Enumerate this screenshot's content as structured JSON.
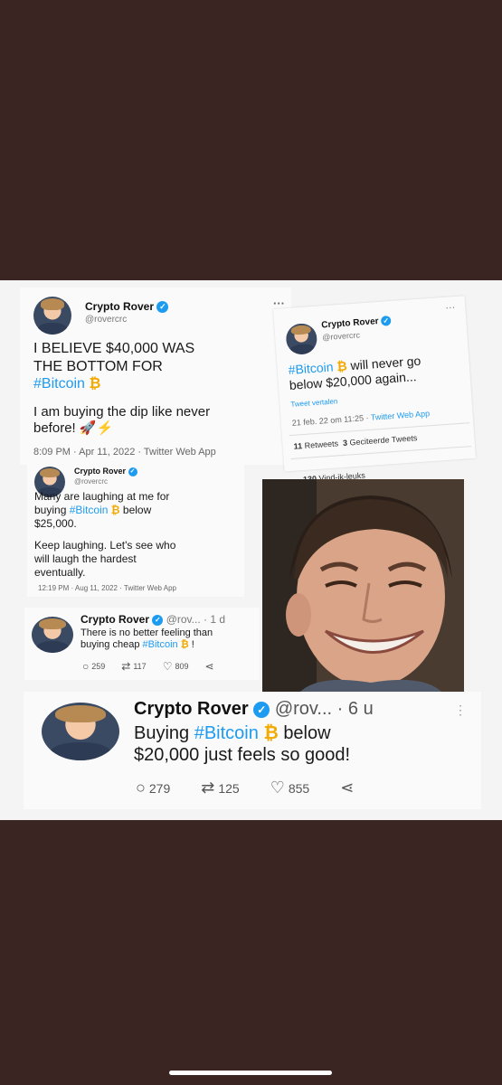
{
  "tweets": [
    {
      "name": "Crypto Rover",
      "handle": "@rovercrc",
      "more": "···",
      "line1": "I BELIEVE $40,000 WAS",
      "line2": "THE BOTTOM FOR",
      "hashtag": "#Bitcoin",
      "btc": "₿",
      "line3": "I am buying the dip like never",
      "line4": "before! 🚀⚡",
      "meta": "8:09 PM · Apr 11, 2022 · Twitter Web App"
    },
    {
      "name": "Crypto Rover",
      "handle": "@rovercrc",
      "hashtag": "#Bitcoin",
      "btc": "₿",
      "line1_rest": "will never go",
      "line2": "below $20,000 again...",
      "translate": "Tweet vertalen",
      "meta_date": "21 feb. 22 om 11:25 ·",
      "meta_app": "Twitter Web App",
      "retweets_count": "11",
      "retweets_label": "Retweets",
      "quotes_count": "3",
      "quotes_label": "Geciteerde Tweets",
      "likes_count": "130",
      "likes_label": "Vind-ik-leuks"
    },
    {
      "name": "Crypto Rover",
      "handle": "@rovercrc",
      "line1": "Many are laughing at me for",
      "line2_pre": "buying",
      "hashtag": "#Bitcoin",
      "btc": "₿",
      "line2_post": "below",
      "line3": "$25,000.",
      "line4": "Keep laughing. Let's see who",
      "line5": "will laugh the hardest",
      "line6": "eventually.",
      "meta": "12:19 PM · Aug 11, 2022 · Twitter Web App"
    },
    {
      "name": "Crypto Rover",
      "handle": "@rov...",
      "time": "· 1 d",
      "line1": "There is no better feeling than",
      "line2_pre": "buying cheap",
      "hashtag": "#Bitcoin",
      "btc": "₿",
      "line2_post": "!",
      "replies": "259",
      "retweets": "117",
      "likes": "809"
    },
    {
      "name": "Crypto Rover",
      "handle": "@rov...",
      "time": "· 6 u",
      "line1_pre": "Buying",
      "hashtag": "#Bitcoin",
      "btc": "₿",
      "line1_post": "below",
      "line2": "$20,000 just feels so good!",
      "replies": "279",
      "retweets": "125",
      "likes": "855"
    }
  ],
  "colors": {
    "background": "#3a2523",
    "twitter_blue": "#1d9bf0",
    "bitcoin_orange": "#f2a900"
  }
}
